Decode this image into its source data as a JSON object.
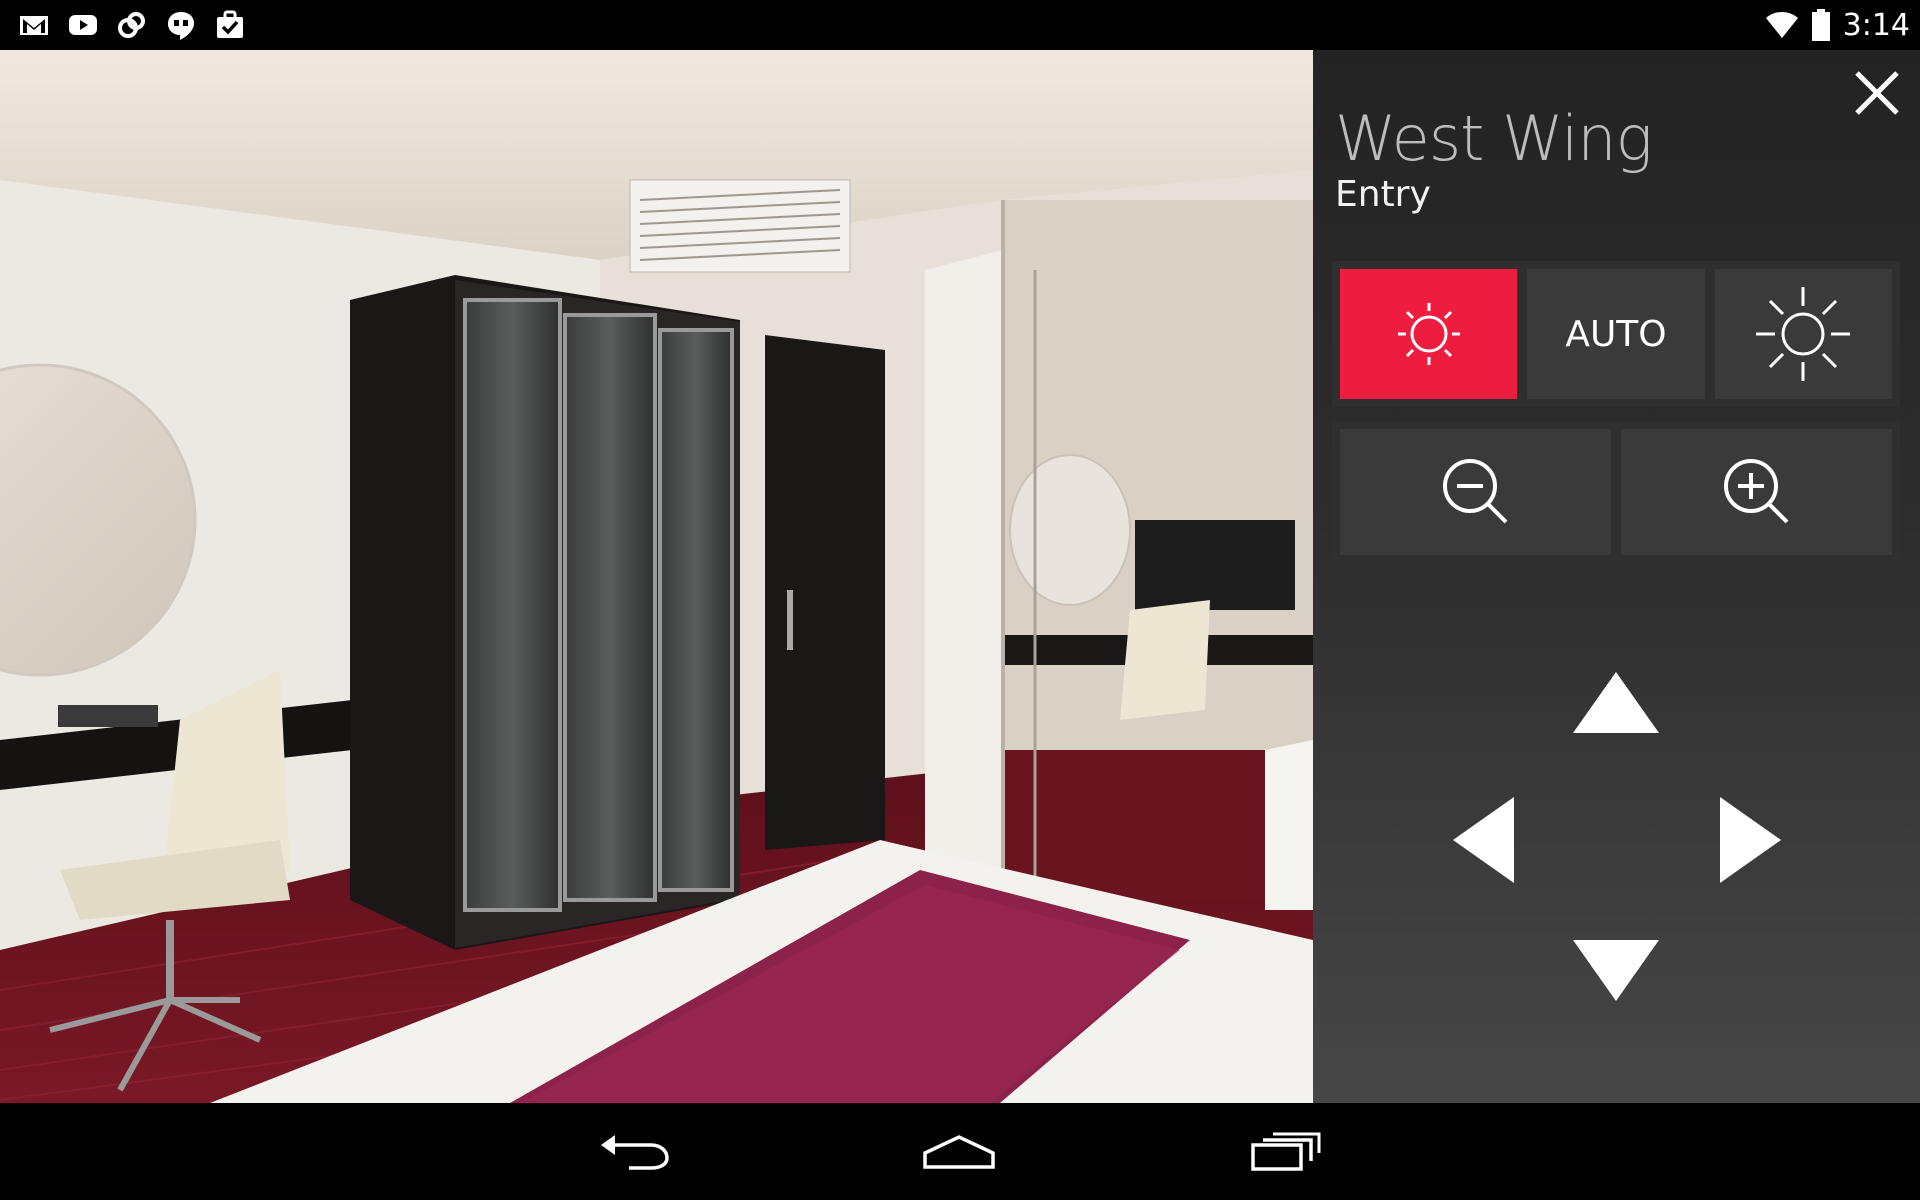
{
  "status_bar": {
    "notification_icons": [
      "gmail-icon",
      "youtube-icon",
      "sync-link-icon",
      "hangouts-icon",
      "tasks-check-icon"
    ],
    "clock": "3:14"
  },
  "camera": {
    "description_icon": "camera-feed"
  },
  "panel": {
    "location": "West Wing",
    "sublocation": "Entry",
    "auto_label": "AUTO",
    "accent_color": "#ee1d3f"
  },
  "nav_bar": {
    "buttons": [
      "back-icon",
      "home-icon",
      "recents-icon"
    ]
  }
}
